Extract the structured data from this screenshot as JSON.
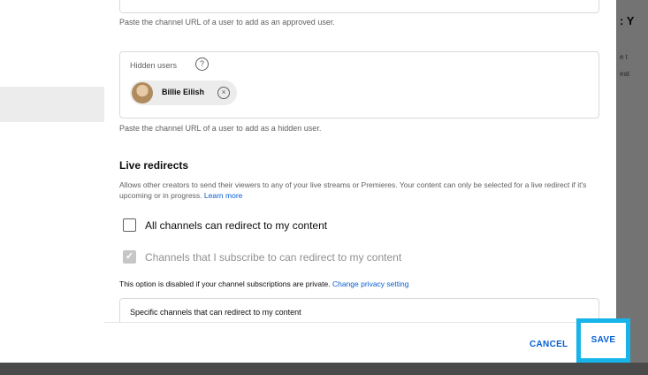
{
  "background": {
    "right_title": ": Y",
    "right_line1": "e t",
    "right_line2": "eat"
  },
  "dialog": {
    "approved_users": {
      "helper": "Paste the channel URL of a user to add as an approved user."
    },
    "hidden_users": {
      "label": "Hidden users",
      "help_icon": "?",
      "chips": [
        {
          "name": "Billie Eilish",
          "remove_icon": "×"
        }
      ],
      "helper": "Paste the channel URL of a user to add as a hidden user."
    },
    "live_redirects": {
      "title": "Live redirects",
      "description": "Allows other creators to send their viewers to any of your live streams or Premieres. Your content can only be selected for a live redirect if it's upcoming or in progress.",
      "learn_more": "Learn more",
      "options": [
        {
          "label": "All channels can redirect to my content",
          "checked": false,
          "disabled": false
        },
        {
          "label": "Channels that I subscribe to can redirect to my content",
          "checked": true,
          "disabled": true
        }
      ],
      "note": "This option is disabled if your channel subscriptions are private.",
      "change_privacy": "Change privacy setting",
      "specific_channels_placeholder": "Specific channels that can redirect to my content"
    },
    "footer": {
      "cancel": "CANCEL",
      "save": "SAVE"
    }
  },
  "colors": {
    "accent": "#065fd4",
    "highlight": "#16b4e8"
  }
}
